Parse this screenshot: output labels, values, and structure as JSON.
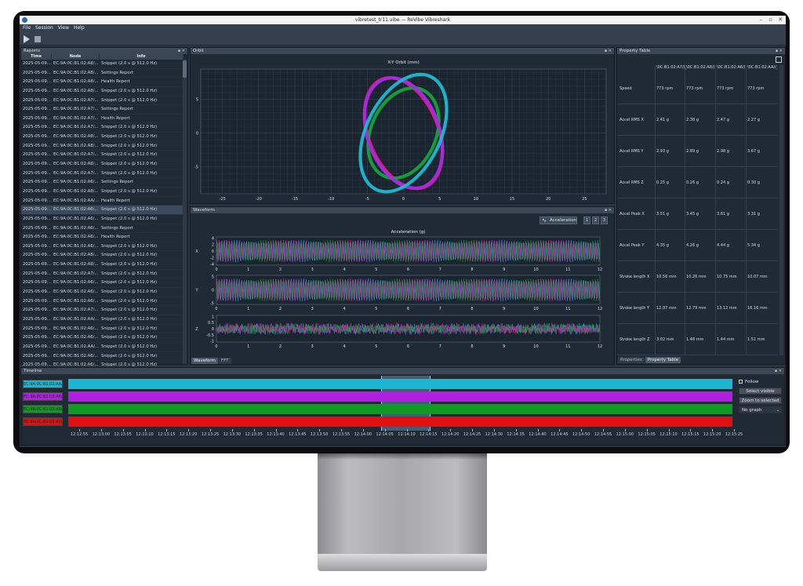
{
  "window": {
    "title": "vibretest_tr11.vibe — ReVibe Vibreshark",
    "controls": [
      "–",
      "▫",
      "✕"
    ]
  },
  "menu": [
    "File",
    "Session",
    "View",
    "Help"
  ],
  "toolbar": {
    "play_icon": "play-icon",
    "stop_icon": "stop-icon"
  },
  "docks": {
    "reports": "Reports",
    "orbit": "Orbit",
    "waveform": "Waveform",
    "property_table": "Property Table",
    "timeline": "Timeline",
    "dock_controls": "▪ ✕"
  },
  "reports": {
    "columns": [
      "Time",
      "Node",
      "Info"
    ],
    "selected_index": 16,
    "rows": [
      [
        "2025-05-09...",
        "EC:9A:0C:B1:02:A8/...",
        "Snippet (2.0 s @ 512.0 Hz)"
      ],
      [
        "2025-05-09...",
        "EC:9A:0C:B1:02:A8/...",
        "Settings Report"
      ],
      [
        "2025-05-09...",
        "EC:9A:0C:B1:02:A8/...",
        "Health Report"
      ],
      [
        "2025-05-09...",
        "EC:9A:0C:B1:02:A8/...",
        "Snippet (2.0 s @ 512.0 Hz)"
      ],
      [
        "2025-05-09...",
        "EC:9A:0C:B1:02:A7/...",
        "Snippet (2.0 s @ 512.0 Hz)"
      ],
      [
        "2025-05-09...",
        "EC:9A:0C:B1:02:A7/...",
        "Settings Report"
      ],
      [
        "2025-05-09...",
        "EC:9A:0C:B1:02:A7/...",
        "Health Report"
      ],
      [
        "2025-05-09...",
        "EC:9A:0C:B1:02:A7/...",
        "Snippet (2.0 s @ 512.0 Hz)"
      ],
      [
        "2025-05-09...",
        "EC:9A:0C:B1:02:A8/...",
        "Snippet (2.0 s @ 512.0 Hz)"
      ],
      [
        "2025-05-09...",
        "EC:9A:0C:B1:02:A8/...",
        "Snippet (2.0 s @ 512.0 Hz)"
      ],
      [
        "2025-05-09...",
        "EC:9A:0C:B1:02:A7/...",
        "Snippet (2.0 s @ 512.0 Hz)"
      ],
      [
        "2025-05-09...",
        "EC:9A:0C:B1:02:A8/...",
        "Snippet (2.0 s @ 512.0 Hz)"
      ],
      [
        "2025-05-09...",
        "EC:9A:0C:B1:02:A7/...",
        "Snippet (2.0 s @ 512.0 Hz)"
      ],
      [
        "2025-05-09...",
        "EC:9A:0C:B1:02:A6/...",
        "Settings Report"
      ],
      [
        "2025-05-09...",
        "EC:9A:0C:B1:02:A8/...",
        "Snippet (2.0 s @ 512.0 Hz)"
      ],
      [
        "2025-05-09...",
        "EC:9A:0C:B1:02:AA/...",
        "Health Report"
      ],
      [
        "2025-05-09...",
        "EC:9A:0C:B1:02:A6/...",
        "Snippet (2.0 s @ 512.0 Hz)"
      ],
      [
        "2025-05-09...",
        "EC:9A:0C:B1:02:A6/...",
        "Snippet (2.0 s @ 512.0 Hz)"
      ],
      [
        "2025-05-09...",
        "EC:9A:0C:B1:02:A6/...",
        "Settings Report"
      ],
      [
        "2025-05-09...",
        "EC:9A:0C:B1:02:A6/...",
        "Health Report"
      ],
      [
        "2025-05-09...",
        "EC:9A:0C:B1:02:A6/...",
        "Snippet (2.0 s @ 512.0 Hz)"
      ],
      [
        "2025-05-09...",
        "EC:9A:0C:B1:02:A8/...",
        "Snippet (2.0 s @ 512.0 Hz)"
      ],
      [
        "2025-05-09...",
        "EC:9A:0C:B1:02:A8/...",
        "Snippet (2.0 s @ 512.0 Hz)"
      ],
      [
        "2025-05-09...",
        "EC:9A:0C:B1:02:A7/...",
        "Snippet (2.0 s @ 512.0 Hz)"
      ],
      [
        "2025-05-09...",
        "EC:9A:0C:B1:02:A6/...",
        "Snippet (2.0 s @ 512.0 Hz)"
      ],
      [
        "2025-05-09...",
        "EC:9A:0C:B1:02:A6/...",
        "Snippet (2.0 s @ 512.0 Hz)"
      ],
      [
        "2025-05-09...",
        "EC:9A:0C:B1:02:A6/...",
        "Snippet (2.0 s @ 512.0 Hz)"
      ],
      [
        "2025-05-09...",
        "EC:9A:0C:B1:02:A7/...",
        "Snippet (2.0 s @ 512.0 Hz)"
      ],
      [
        "2025-05-09...",
        "EC:9A:0C:B1:02:AA/...",
        "Snippet (2.0 s @ 512.0 Hz)"
      ],
      [
        "2025-05-09...",
        "EC:9A:0C:B1:02:A6/...",
        "Snippet (2.0 s @ 512.0 Hz)"
      ],
      [
        "2025-05-09...",
        "EC:9A:0C:B1:02:A6/...",
        "Snippet (2.0 s @ 512.0 Hz)"
      ],
      [
        "2025-05-09...",
        "EC:9A:0C:B1:02:AA/...",
        "Snippet (2.0 s @ 512.0 Hz)"
      ],
      [
        "2025-05-09...",
        "EC:9A:0C:B1:02:A6/...",
        "Snippet (2.0 s @ 512.0 Hz)"
      ],
      [
        "2025-05-09...",
        "EC:9A:0C:B1:02:A6/...",
        "Snippet (2.0 s @ 512.0 Hz)"
      ]
    ]
  },
  "chart_data": [
    {
      "type": "scatter",
      "title": "X-Y Orbit (mm)",
      "xlim": [
        -28,
        28
      ],
      "ylim": [
        -9,
        9.5
      ],
      "xticks": [
        -25,
        -20,
        -15,
        -10,
        -5,
        0,
        5,
        10,
        15,
        20,
        25
      ],
      "yticks": [
        5,
        0,
        -5
      ],
      "grid": true,
      "series": [
        {
          "color": "#e0177a",
          "cx": 0,
          "cy": 0,
          "rx": 3.1,
          "ry": 8.6,
          "rot_deg": -22
        },
        {
          "color": "#14a33a",
          "cx": 0,
          "cy": 0,
          "rx": 2.9,
          "ry": 7.0,
          "rot_deg": 24
        },
        {
          "color": "#a72be0",
          "cx": 0,
          "cy": 0,
          "rx": 3.2,
          "ry": 8.5,
          "rot_deg": -20
        },
        {
          "color": "#1fb8d0",
          "cx": 0,
          "cy": 0,
          "rx": 3.3,
          "ry": 9.3,
          "rot_deg": 26
        }
      ]
    },
    {
      "type": "line",
      "title": "Acceleration (g)",
      "x_range": [
        0,
        12
      ],
      "xticks": [
        0,
        1,
        2,
        3,
        4,
        5,
        6,
        7,
        8,
        9,
        10,
        11,
        12
      ],
      "axes": [
        {
          "label": "X",
          "yticks": [
            4,
            2,
            0,
            -2,
            -4
          ],
          "amplitude": 4
        },
        {
          "label": "Y",
          "yticks": [
            5,
            0,
            -5
          ],
          "amplitude": 5
        },
        {
          "label": "Z",
          "yticks": [
            1.0,
            0.5,
            0.0,
            -0.5,
            -1.0
          ],
          "amplitude": 1.0
        }
      ],
      "series_colors": [
        "#1fb8d0",
        "#a72be0",
        "#e0177a",
        "#14a33a"
      ]
    }
  ],
  "waveform_toolbar": {
    "signal": "Acceleration",
    "axis_buttons": [
      "1",
      "2",
      "3"
    ]
  },
  "waveform_tabs": [
    "Waveform",
    "FFT"
  ],
  "property_tabs": [
    "Properties",
    "Property Table"
  ],
  "property_table": {
    "columns": [
      "\\0C:B1:02:A7/()",
      "\\0C:B1:02:A8/()",
      "\\0C:B1:02:A6/()",
      "\\0C:B1:02:AA/()"
    ],
    "rows": [
      {
        "label": "Speed",
        "values": [
          "773 rpm",
          "773 rpm",
          "773 rpm",
          "773 rpm"
        ]
      },
      {
        "label": "Accel RMS X",
        "values": [
          "2.41 g",
          "2.38 g",
          "2.47 g",
          "2.27 g"
        ]
      },
      {
        "label": "Accel RMS Y",
        "values": [
          "2.93 g",
          "2.89 g",
          "2.98 g",
          "3.67 g"
        ]
      },
      {
        "label": "Accel RMS Z",
        "values": [
          "0.25 g",
          "0.26 g",
          "0.24 g",
          "0.30 g"
        ]
      },
      {
        "label": "Accel Peak X",
        "values": [
          "3.51 g",
          "3.45 g",
          "3.61 g",
          "3.31 g"
        ]
      },
      {
        "label": "Accel Peak Y",
        "values": [
          "4.35 g",
          "4.26 g",
          "4.44 g",
          "5.34 g"
        ]
      },
      {
        "label": "Stroke length X",
        "values": [
          "10.56 mm",
          "10.26 mm",
          "10.75 mm",
          "10.07 mm"
        ]
      },
      {
        "label": "Stroke length Y",
        "values": [
          "12.97 mm",
          "12.79 mm",
          "13.12 mm",
          "16.16 mm"
        ]
      },
      {
        "label": "Stroke length Z",
        "values": [
          "3.02 mm",
          "1.48 mm",
          "1.44 mm",
          "1.51 mm"
        ]
      }
    ]
  },
  "timeline": {
    "tracks": [
      {
        "label": "EC:9A:0C:B1:02:AA/()",
        "color": "#1cb6d2"
      },
      {
        "label": "EC:9A:0C:B1:02:A6/()",
        "color": "#b21fe3"
      },
      {
        "label": "EC:9A:0C:B1:02:A8/()",
        "color": "#0f9a22"
      },
      {
        "label": "EC:9A:0C:B1:02:A7/()",
        "color": "#e01010"
      }
    ],
    "selection_highlight": "#5fb4e6",
    "ticks": [
      "12:12:55",
      "12:13:00",
      "12:13:05",
      "12:13:10",
      "12:13:15",
      "12:13:20",
      "12:13:25",
      "12:13:30",
      "12:13:35",
      "12:13:40",
      "12:13:45",
      "12:13:50",
      "12:13:55",
      "12:14:00",
      "12:14:05",
      "12:14:10",
      "12:14:15",
      "12:14:20",
      "12:14:25",
      "12:14:30",
      "12:14:35",
      "12:14:40",
      "12:14:45",
      "12:14:50",
      "12:14:55",
      "12:15:00",
      "12:15:05",
      "12:15:10",
      "12:15:15",
      "12:15:20",
      "12:15:25"
    ],
    "follow_label": "Follow",
    "buttons": [
      "Select visible",
      "Zoom to selected"
    ],
    "graph_select": "No graph"
  }
}
